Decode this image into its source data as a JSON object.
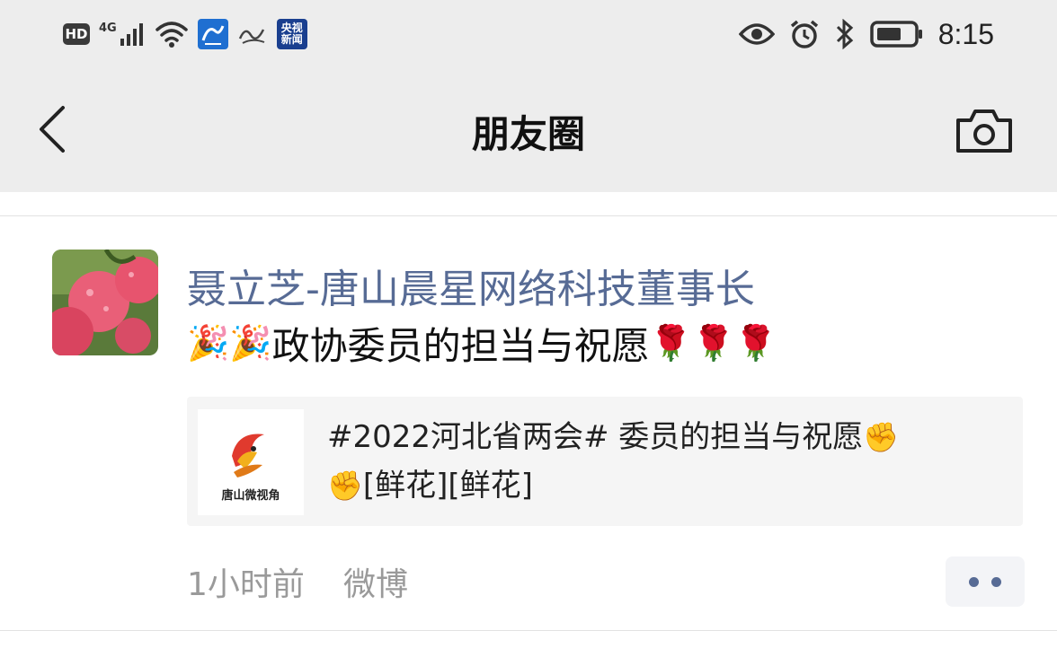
{
  "status_bar": {
    "hd_label": "HD",
    "network_label": "4G",
    "app_icons": [
      {
        "name": "news-app-1",
        "icon": "ink-calligraphy-icon"
      },
      {
        "name": "news-app-2",
        "icon": "xuexi-icon"
      },
      {
        "name": "cctv-news",
        "label": "央视新闻"
      }
    ],
    "time": "8:15",
    "indicators": [
      "eye-icon",
      "alarm-icon",
      "bluetooth-icon",
      "battery-icon"
    ]
  },
  "nav": {
    "title": "朋友圈",
    "back_icon": "chevron-left-icon",
    "camera_icon": "camera-icon"
  },
  "post": {
    "author": "聂立芝-唐山晨星网络科技董事长",
    "emoji_prefix": [
      "🎉",
      "🎉"
    ],
    "text": "政协委员的担当与祝愿",
    "emoji_suffix": [
      "🌹",
      "🌹",
      "🌹"
    ],
    "link": {
      "thumb_label": "唐山微视角",
      "line1_text": "#2022河北省两会# 委员的担当与祝愿",
      "line1_emoji": "✊",
      "line2_emoji": "✊",
      "line2_text": "[鲜花][鲜花]"
    },
    "time": "1小时前",
    "source": "微博"
  },
  "colors": {
    "bar_background": "#ededed",
    "author_link": "#576b95",
    "meta_text": "#9a9a9a",
    "card_background": "#f5f5f5"
  }
}
